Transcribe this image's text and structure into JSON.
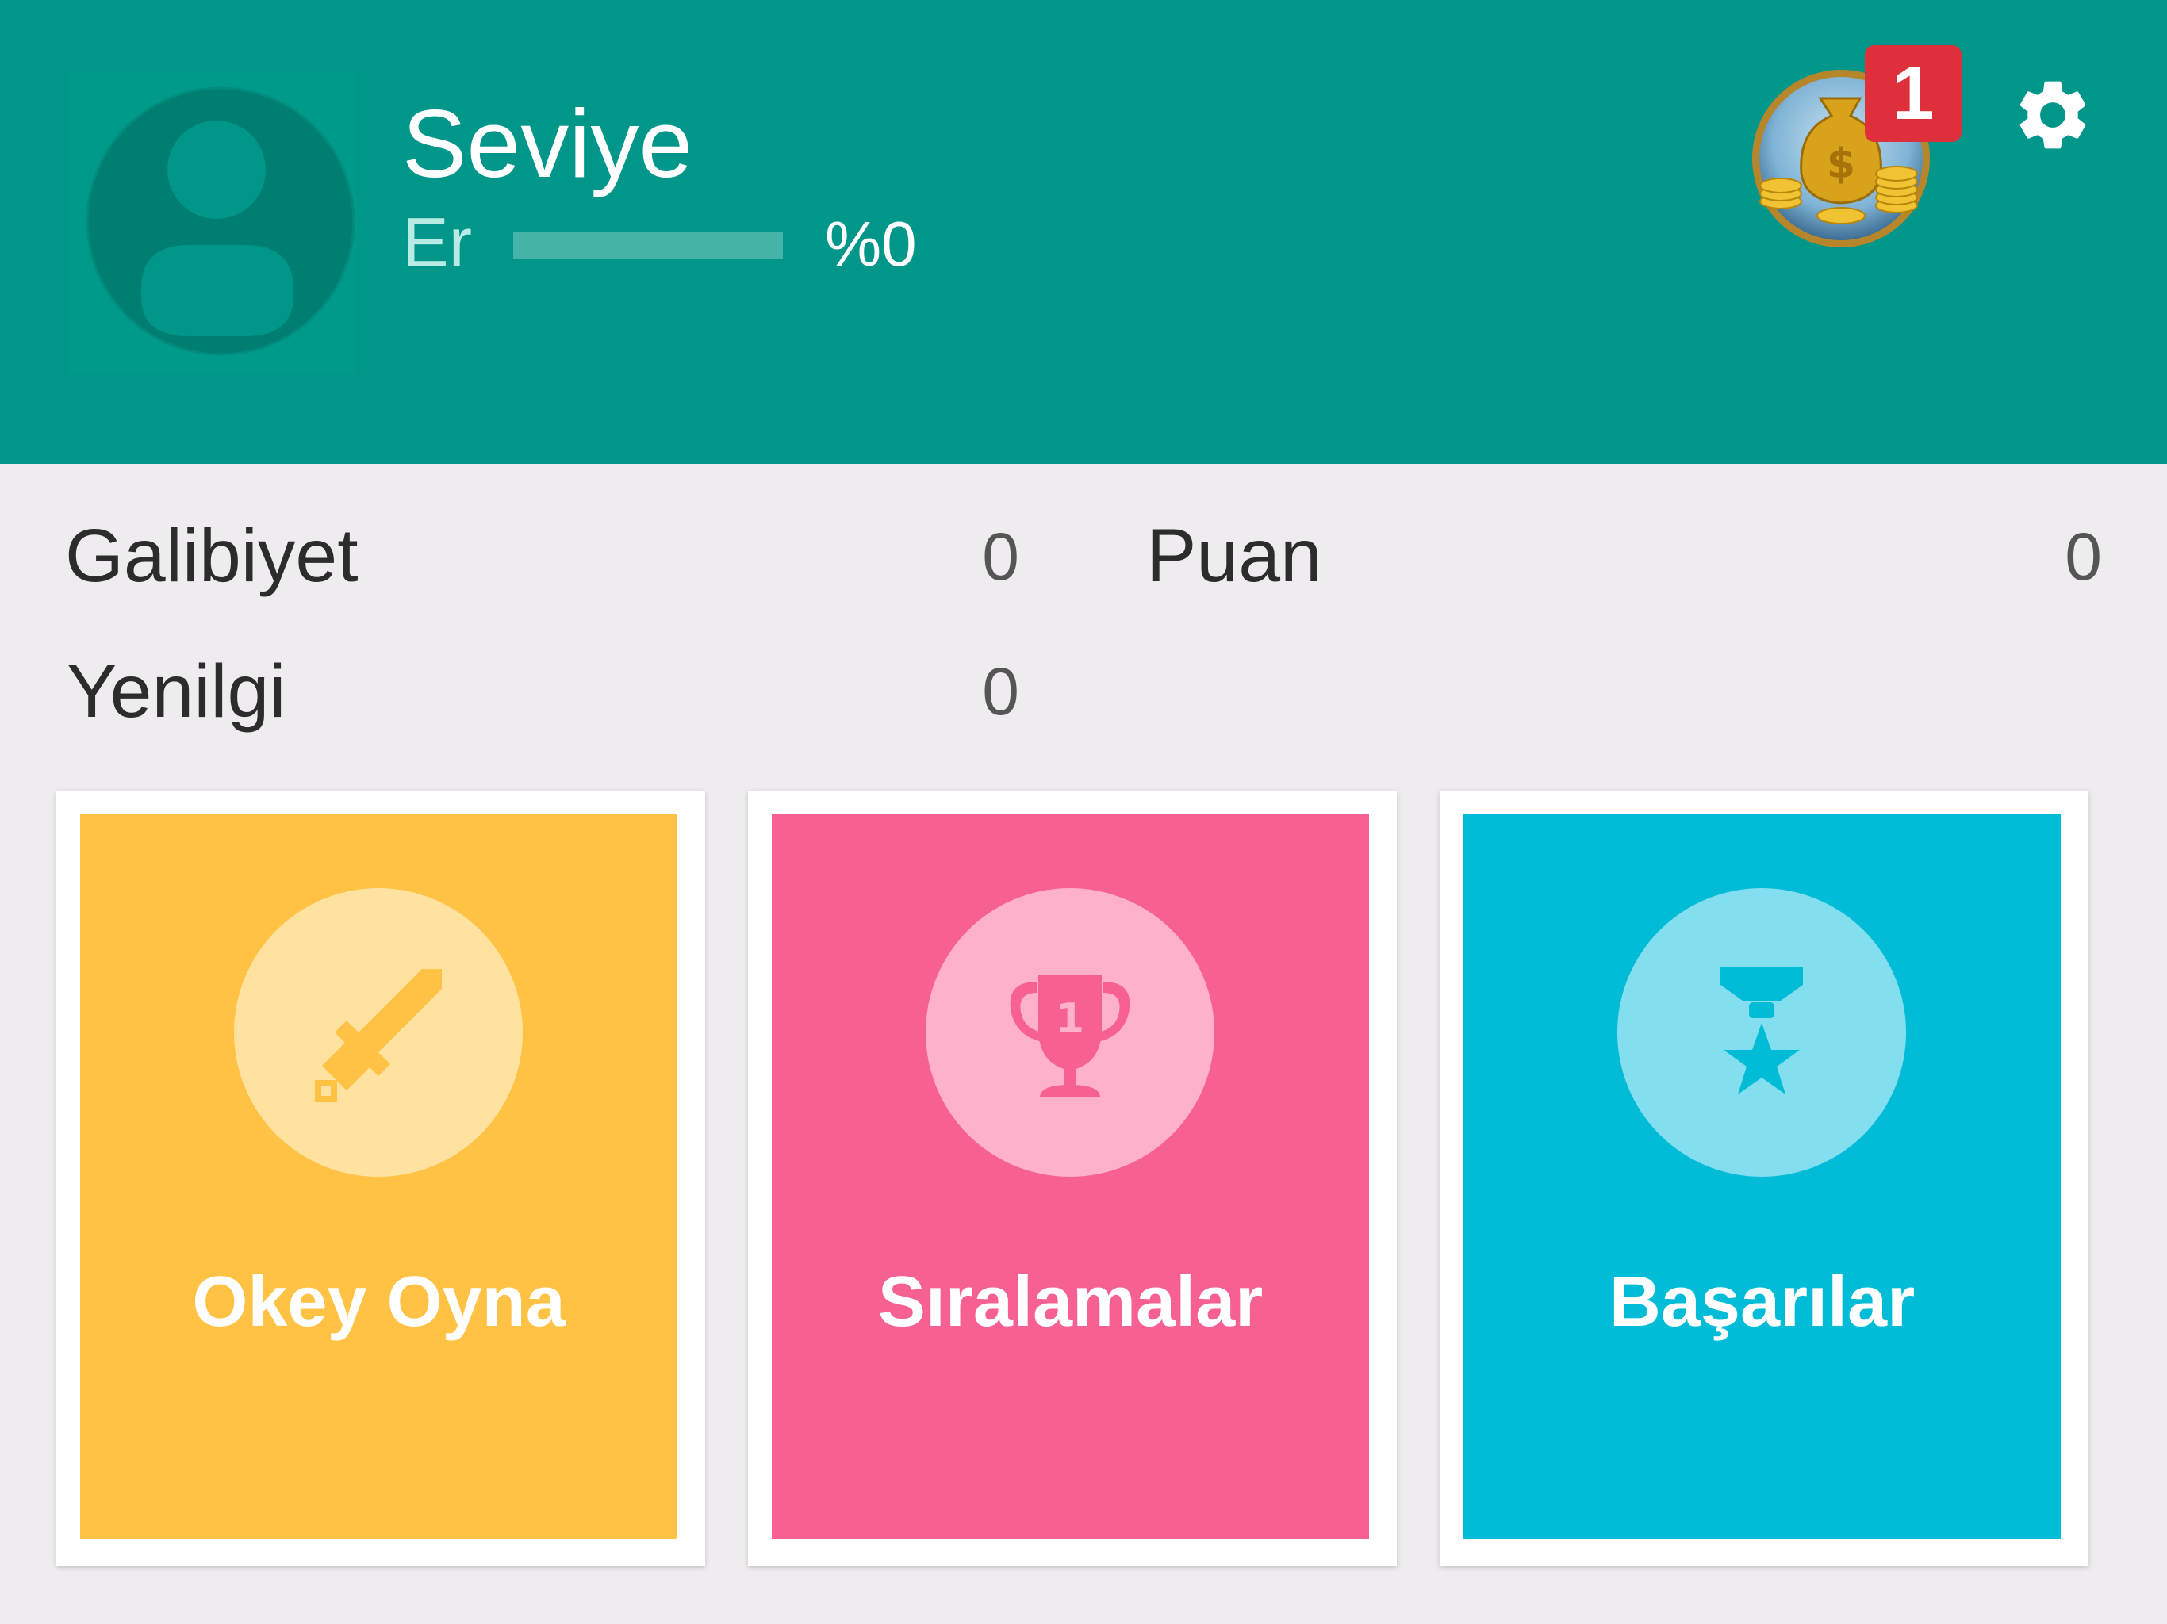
{
  "header": {
    "level_title": "Seviye",
    "rank": "Er",
    "progress_percent": 0,
    "progress_text": "%0",
    "coin_badge_count": "1"
  },
  "stats": {
    "wins_label": "Galibiyet",
    "wins_value": "0",
    "points_label": "Puan",
    "points_value": "0",
    "losses_label": "Yenilgi",
    "losses_value": "0"
  },
  "cards": [
    {
      "label": "Okey Oyna",
      "icon": "sword-icon",
      "bg": "#ffc244",
      "circle": "#ffe29f"
    },
    {
      "label": "Sıralamalar",
      "icon": "trophy-icon",
      "bg": "#f76192",
      "circle": "#ffb0cb"
    },
    {
      "label": "Başarılar",
      "icon": "medal-icon",
      "bg": "#01bcd7",
      "circle": "#83def0"
    }
  ],
  "colors": {
    "header_bg": "#00968a",
    "page_bg": "#efecef",
    "badge_red": "#df2f3a"
  }
}
